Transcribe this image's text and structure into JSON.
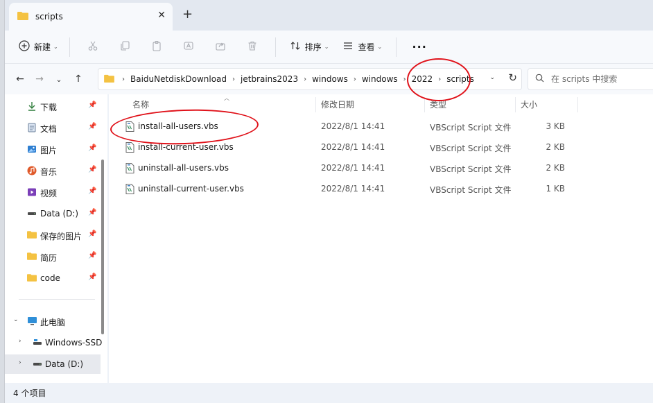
{
  "tab": {
    "title": "scripts"
  },
  "toolbar": {
    "new_label": "新建",
    "sort_label": "排序",
    "view_label": "查看"
  },
  "address": {
    "crumbs": [
      "BaiduNetdiskDownload",
      "jetbrains2023",
      "windows",
      "windows",
      "2022",
      "scripts"
    ]
  },
  "search": {
    "placeholder": "在 scripts 中搜索"
  },
  "nav": {
    "quick": [
      {
        "label": "下载",
        "icon": "download-icon"
      },
      {
        "label": "文档",
        "icon": "document-icon"
      },
      {
        "label": "图片",
        "icon": "pictures-icon"
      },
      {
        "label": "音乐",
        "icon": "music-icon"
      },
      {
        "label": "视频",
        "icon": "video-icon"
      },
      {
        "label": "Data (D:)",
        "icon": "drive-icon"
      },
      {
        "label": "保存的图片",
        "icon": "folder-icon"
      },
      {
        "label": "简历",
        "icon": "folder-icon"
      },
      {
        "label": "code",
        "icon": "folder-icon"
      }
    ],
    "this_pc": "此电脑",
    "drives": [
      "Windows-SSD",
      "Data (D:)"
    ]
  },
  "columns": {
    "name": "名称",
    "date": "修改日期",
    "type": "类型",
    "size": "大小"
  },
  "files": [
    {
      "name": "install-all-users.vbs",
      "date": "2022/8/1 14:41",
      "type": "VBScript Script 文件",
      "size": "3 KB"
    },
    {
      "name": "install-current-user.vbs",
      "date": "2022/8/1 14:41",
      "type": "VBScript Script 文件",
      "size": "2 KB"
    },
    {
      "name": "uninstall-all-users.vbs",
      "date": "2022/8/1 14:41",
      "type": "VBScript Script 文件",
      "size": "2 KB"
    },
    {
      "name": "uninstall-current-user.vbs",
      "date": "2022/8/1 14:41",
      "type": "VBScript Script 文件",
      "size": "1 KB"
    }
  ],
  "status": {
    "item_count": "4 个项目"
  },
  "colors": {
    "folder": "#f4c242",
    "annotation": "#e0121a",
    "window_bg": "#eef2f8"
  }
}
